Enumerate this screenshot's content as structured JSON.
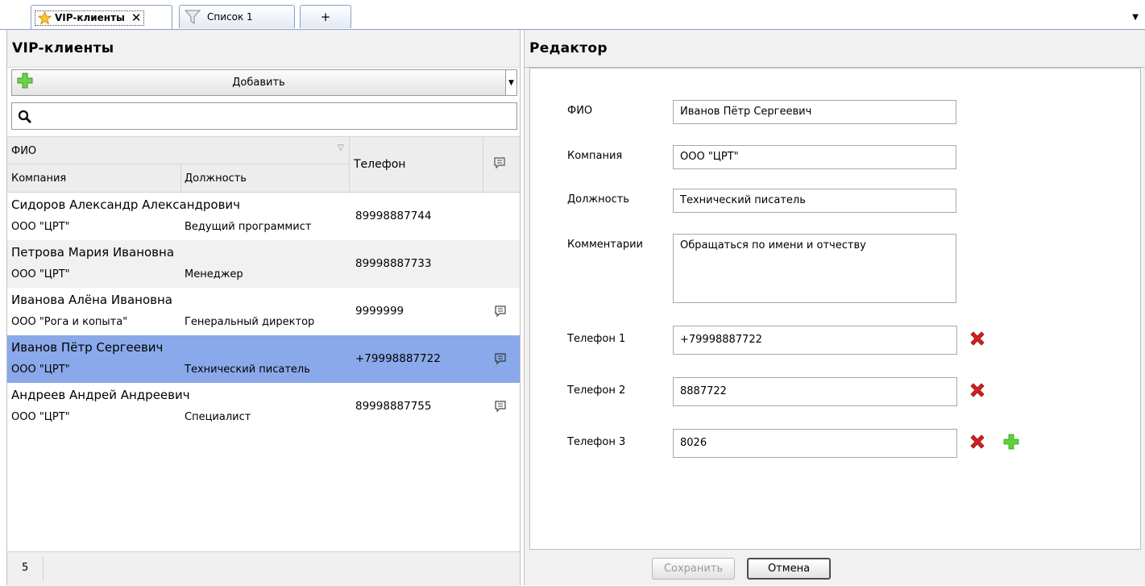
{
  "tabs": [
    {
      "label": "VIP-клиенты",
      "active": true,
      "icon": "star-icon"
    },
    {
      "label": "Список 1",
      "active": false,
      "icon": "filter-icon"
    },
    {
      "label": "+",
      "active": false
    }
  ],
  "close_glyph": "✕",
  "overflow_glyph": "▼",
  "left_panel": {
    "title": "VIP-клиенты",
    "add_label": "Добавить",
    "search_value": "",
    "columns": {
      "fio": "ФИО",
      "company": "Компания",
      "position": "Должность",
      "phone": "Телефон"
    },
    "rows": [
      {
        "name": "Сидоров  Александр Александрович",
        "company": "ООО \"ЦРТ\"",
        "position": "Ведущий программист",
        "phone": "89998887744",
        "has_comment": false
      },
      {
        "name": "Петрова Мария Ивановна",
        "company": "ООО \"ЦРТ\"",
        "position": "Менеджер",
        "phone": "89998887733",
        "has_comment": false
      },
      {
        "name": "Иванова Алёна Ивановна",
        "company": "ООО \"Рога и копыта\"",
        "position": "Генеральный директор",
        "phone": "9999999",
        "has_comment": true
      },
      {
        "name": "Иванов Пётр Сергеевич",
        "company": "ООО \"ЦРТ\"",
        "position": "Технический писатель",
        "phone": "+79998887722",
        "has_comment": true,
        "selected": true
      },
      {
        "name": "Андреев Андрей Андреевич",
        "company": "ООО \"ЦРТ\"",
        "position": "Специалист",
        "phone": "89998887755",
        "has_comment": true
      }
    ],
    "record_count": "5"
  },
  "editor": {
    "title": "Редактор",
    "fields": {
      "fio_label": "ФИО",
      "fio_value": "Иванов Пётр Сергеевич",
      "company_label": "Компания",
      "company_value": "ООО \"ЦРТ\"",
      "position_label": "Должность",
      "position_value": "Технический писатель",
      "comment_label": "Комментарии",
      "comment_value": "Обращаться по имени и отчеству"
    },
    "phones": [
      {
        "label": "Телефон 1",
        "value": "+79998887722"
      },
      {
        "label": "Телефон 2",
        "value": "8887722"
      },
      {
        "label": "Телефон 3",
        "value": "8026"
      }
    ],
    "save_label": "Сохранить",
    "save_enabled": false,
    "cancel_label": "Отмена"
  },
  "colors": {
    "selected_row": "#8aa9ea",
    "delete_red": "#d42020",
    "add_green": "#3cc43c"
  }
}
